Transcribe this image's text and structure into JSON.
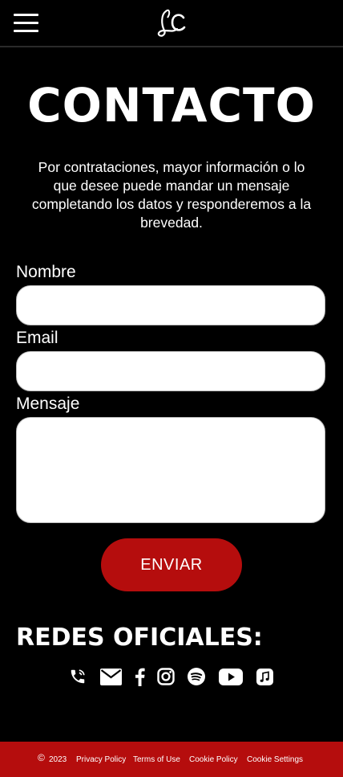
{
  "header": {
    "menu_icon": "hamburger-menu-icon",
    "logo_icon": "lc-monogram-logo"
  },
  "main": {
    "title": "CONTACTO",
    "intro": "Por contrataciones, mayor información o lo que desee puede mandar un mensaje completando los datos y responderemos a la brevedad."
  },
  "form": {
    "name_label": "Nombre",
    "name_value": "",
    "email_label": "Email",
    "email_value": "",
    "message_label": "Mensaje",
    "message_value": "",
    "submit_label": "ENVIAR"
  },
  "socials": {
    "title": "REDES OFICIALES:",
    "icons": [
      "phone-icon",
      "email-icon",
      "facebook-icon",
      "instagram-icon",
      "spotify-icon",
      "youtube-icon",
      "apple-music-icon"
    ]
  },
  "footer": {
    "copyright_symbol": "©",
    "year": "2023",
    "privacy": "Privacy Policy",
    "terms": "Terms of Use",
    "cookie_policy": "Cookie Policy",
    "cookie_settings": "Cookie Settings"
  },
  "colors": {
    "background": "#000000",
    "accent": "#b50d0d",
    "text": "#ffffff"
  }
}
